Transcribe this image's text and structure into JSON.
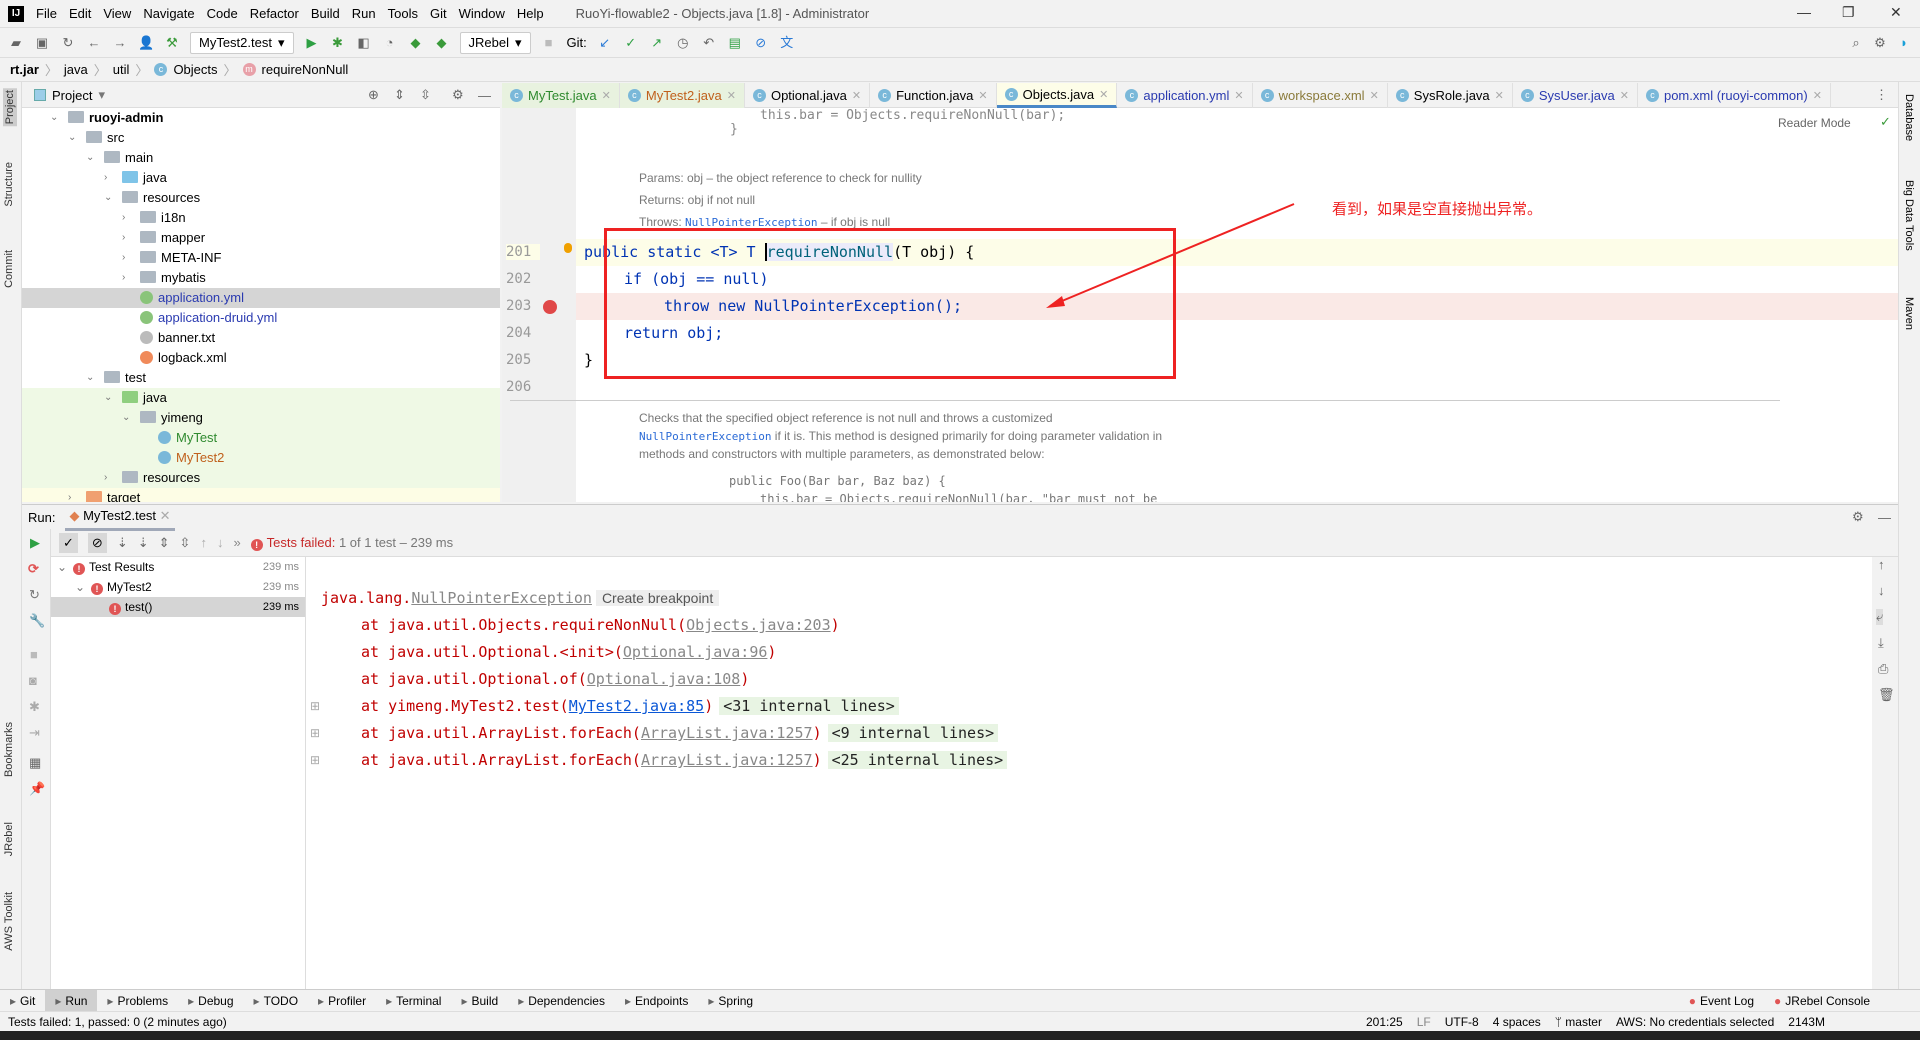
{
  "app": {
    "logo": "IJ",
    "title": "RuoYi-flowable2 - Objects.java [1.8] - Administrator",
    "menu": [
      "File",
      "Edit",
      "View",
      "Navigate",
      "Code",
      "Refactor",
      "Build",
      "Run",
      "Tools",
      "Git",
      "Window",
      "Help"
    ]
  },
  "toolbar": {
    "run_config": "MyTest2.test",
    "jrebel": "JRebel",
    "git_label": "Git:"
  },
  "breadcrumb": [
    "rt.jar",
    "java",
    "util",
    "Objects",
    "requireNonNull"
  ],
  "left_stripe": [
    "Project",
    "Structure",
    "Commit",
    "Bookmarks",
    "JRebel",
    "AWS Toolkit"
  ],
  "right_stripe": [
    "Database",
    "Big Data Tools",
    "Maven"
  ],
  "project": {
    "title": "Project",
    "tree": [
      {
        "label": "ruoyi-admin",
        "depth": 0,
        "arrow": "down",
        "bold": true
      },
      {
        "label": "src",
        "depth": 1,
        "arrow": "down"
      },
      {
        "label": "main",
        "depth": 2,
        "arrow": "down"
      },
      {
        "label": "java",
        "depth": 3,
        "arrow": "right",
        "color": "#7fc4e8"
      },
      {
        "label": "resources",
        "depth": 3,
        "arrow": "down"
      },
      {
        "label": "i18n",
        "depth": 4,
        "arrow": "right"
      },
      {
        "label": "mapper",
        "depth": 4,
        "arrow": "right"
      },
      {
        "label": "META-INF",
        "depth": 4,
        "arrow": "right"
      },
      {
        "label": "mybatis",
        "depth": 4,
        "arrow": "right"
      },
      {
        "label": "application.yml",
        "depth": 4,
        "file": true,
        "textcolor": "#2a3ab0",
        "selected": true
      },
      {
        "label": "application-druid.yml",
        "depth": 4,
        "file": true,
        "textcolor": "#2a3ab0"
      },
      {
        "label": "banner.txt",
        "depth": 4,
        "file": true
      },
      {
        "label": "logback.xml",
        "depth": 4,
        "file": true
      },
      {
        "label": "test",
        "depth": 2,
        "arrow": "down"
      },
      {
        "label": "java",
        "depth": 3,
        "arrow": "down",
        "color": "#8fcf7f",
        "green": true
      },
      {
        "label": "yimeng",
        "depth": 4,
        "arrow": "down",
        "green": true
      },
      {
        "label": "MyTest",
        "depth": 5,
        "file": true,
        "textcolor": "#2f8a2f",
        "green": true
      },
      {
        "label": "MyTest2",
        "depth": 5,
        "file": true,
        "textcolor": "#c0601c",
        "green": true
      },
      {
        "label": "resources",
        "depth": 3,
        "arrow": "right",
        "green": true
      },
      {
        "label": "target",
        "depth": 1,
        "arrow": "right",
        "color": "#f0a070",
        "yellow": true
      }
    ]
  },
  "editor_tabs": [
    {
      "label": "MyTest.java",
      "color": "#2f8a2f"
    },
    {
      "label": "MyTest2.java",
      "color": "#c0601c"
    },
    {
      "label": "Optional.java",
      "color": "#000"
    },
    {
      "label": "Function.java",
      "color": "#000"
    },
    {
      "label": "Objects.java",
      "color": "#000",
      "active": true
    },
    {
      "label": "application.yml",
      "color": "#2a3ab0"
    },
    {
      "label": "workspace.xml",
      "color": "#8a7a3a"
    },
    {
      "label": "SysRole.java",
      "color": "#000"
    },
    {
      "label": "SysUser.java",
      "color": "#2a3ab0"
    },
    {
      "label": "pom.xml (ruoyi-common)",
      "color": "#2a3ab0"
    }
  ],
  "editor": {
    "reader_mode": "Reader Mode",
    "doc_top": [
      "this.bar = Objects.requireNonNull(bar);",
      "}"
    ],
    "doc_params": "Params: obj – the object reference to check for nullity",
    "doc_returns": "Returns: obj if not null",
    "doc_throws_label": "Throws:",
    "doc_throws_link": "NullPointerException",
    "doc_throws_rest": "– if obj is null",
    "lines": [
      {
        "num": "201",
        "pre": "public static ",
        "kw": "",
        "rest": "<T> T ",
        "hl": "requireNonNull",
        "tail": "(T obj) {"
      },
      {
        "num": "202",
        "code": "if (obj == null)"
      },
      {
        "num": "203",
        "code": "throw new NullPointerException();"
      },
      {
        "num": "204",
        "code": "return obj;"
      },
      {
        "num": "205",
        "code": "}"
      },
      {
        "num": "206",
        "code": ""
      }
    ],
    "doc2_1": "Checks that the specified object reference is not null and throws a customized",
    "doc2_2_link": "NullPointerException",
    "doc2_2": " if it is. This method is designed primarily for doing parameter validation in",
    "doc2_3": "methods and constructors with multiple parameters, as demonstrated below:",
    "doc2_4": "public Foo(Bar bar, Baz baz) {",
    "doc2_5": "this.bar = Objects.requireNonNull(bar, \"bar must not be",
    "annotation": "看到，如果是空直接抛出异常。",
    "annotation_color": "#ee2222"
  },
  "run": {
    "label": "Run:",
    "tab": "MyTest2.test",
    "status_prefix": "Tests failed:",
    "status_rest": "1 of 1 test – 239 ms",
    "tree": [
      {
        "label": "Test Results",
        "ms": "239 ms",
        "depth": 0
      },
      {
        "label": "MyTest2",
        "ms": "239 ms",
        "depth": 1
      },
      {
        "label": "test()",
        "ms": "239 ms",
        "depth": 2,
        "selected": true
      }
    ],
    "console": {
      "exc_prefix": "java.lang.",
      "exc_link": "NullPointerException",
      "tooltip": "Create breakpoint",
      "frames": [
        {
          "text": "at java.util.Objects.requireNonNull(",
          "link": "Objects.java:203",
          "end": ")"
        },
        {
          "text": "at java.util.Optional.<init>(",
          "link": "Optional.java:96",
          "end": ")"
        },
        {
          "text": "at java.util.Optional.of(",
          "link": "Optional.java:108",
          "end": ")"
        },
        {
          "text": "at yimeng.MyTest2.test(",
          "link": "MyTest2.java:85",
          "end": ")",
          "internal": "<31 internal lines>",
          "blue": true
        },
        {
          "text": "at java.util.ArrayList.forEach(",
          "link": "ArrayList.java:1257",
          "end": ")",
          "internal": "<9 internal lines>"
        },
        {
          "text": "at java.util.ArrayList.forEach(",
          "link": "ArrayList.java:1257",
          "end": ")",
          "internal": "<25 internal lines>"
        }
      ]
    }
  },
  "bottom_tabs": [
    "Git",
    "Run",
    "Problems",
    "Debug",
    "TODO",
    "Profiler",
    "Terminal",
    "Build",
    "Dependencies",
    "Endpoints",
    "Spring"
  ],
  "bottom_right": [
    "Event Log",
    "JRebel Console"
  ],
  "status": {
    "message": "Tests failed: 1, passed: 0 (2 minutes ago)",
    "position": "201:25",
    "line_sep": "LF",
    "encoding": "UTF-8",
    "indent": "4 spaces",
    "branch": "master",
    "aws": "AWS: No credentials selected",
    "memory": "2143M"
  }
}
